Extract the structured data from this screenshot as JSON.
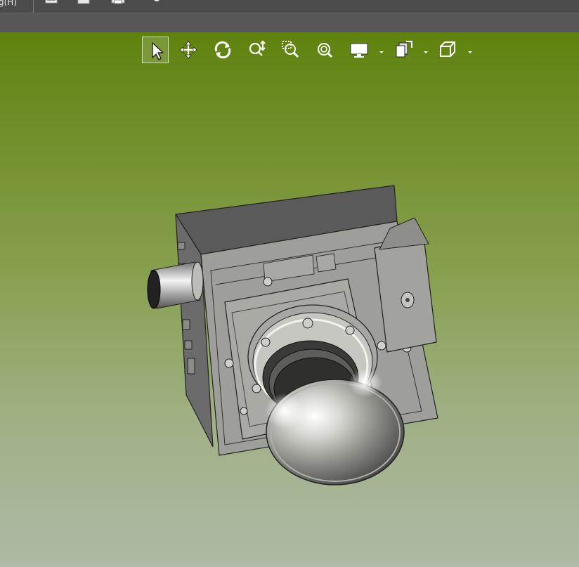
{
  "menu": {
    "partial_label": "g(H)"
  },
  "quick_access": [
    {
      "name": "open-icon"
    },
    {
      "name": "save-icon"
    },
    {
      "name": "print-icon"
    },
    {
      "name": "settings-icon"
    }
  ],
  "view_toolbar": {
    "tools": [
      {
        "name": "select-icon",
        "active": true
      },
      {
        "name": "pan-icon"
      },
      {
        "name": "rotate-icon"
      },
      {
        "name": "zoom-icon"
      },
      {
        "name": "zoom-window-icon"
      },
      {
        "name": "zoom-fit-icon"
      },
      {
        "name": "display-mode-icon",
        "dropdown": true
      },
      {
        "name": "views-icon",
        "dropdown": true
      },
      {
        "name": "view-cube-icon",
        "dropdown": true
      }
    ]
  },
  "colors": {
    "viewport_top": "#5f820e",
    "viewport_bottom": "#adbaa6",
    "chrome": "#4b4b4b"
  },
  "model": {
    "name": "camera-assembly-model"
  }
}
